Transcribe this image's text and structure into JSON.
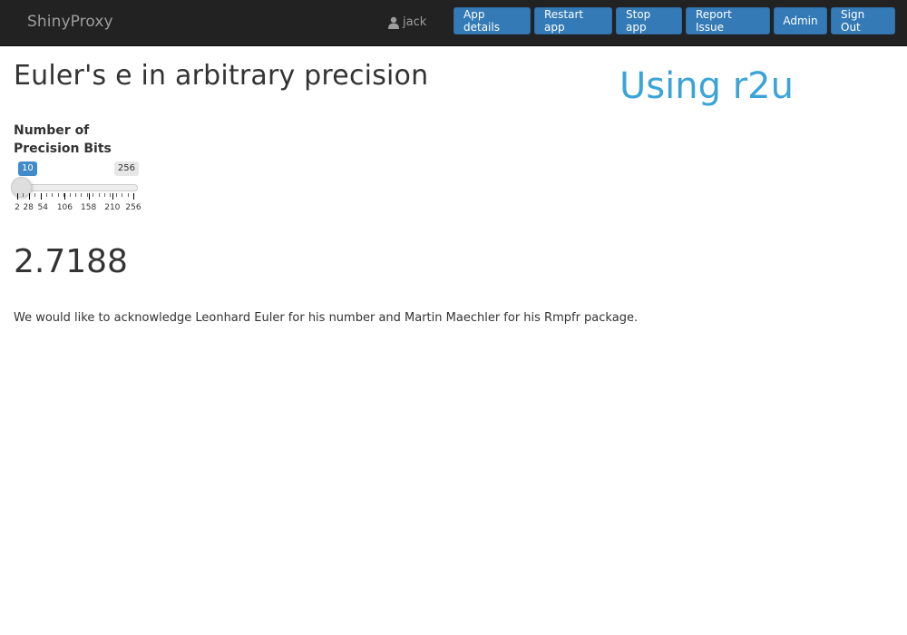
{
  "navbar": {
    "brand": "ShinyProxy",
    "user": {
      "icon": "user-icon",
      "name": "jack"
    },
    "buttons": [
      {
        "id": "app-details",
        "label": "App details"
      },
      {
        "id": "restart-app",
        "label": "Restart app"
      },
      {
        "id": "stop-app",
        "label": "Stop app"
      },
      {
        "id": "report-issue",
        "label": "Report Issue"
      },
      {
        "id": "admin",
        "label": "Admin"
      },
      {
        "id": "sign-out",
        "label": "Sign Out"
      }
    ]
  },
  "main": {
    "title": "Euler's e in arbitrary precision",
    "side_heading": "Using r2u",
    "slider": {
      "label": "Number of Precision Bits",
      "min": 2,
      "max": 256,
      "value": 10,
      "value_label": "10",
      "max_label": "256",
      "grid_labels": [
        2,
        28,
        54,
        106,
        158,
        210,
        256
      ],
      "accent_color": "#428bca"
    },
    "result": "2.7188",
    "acknowledgement": "We would like to acknowledge Leonhard Euler for his number and Martin Maechler for his Rmpfr package."
  }
}
